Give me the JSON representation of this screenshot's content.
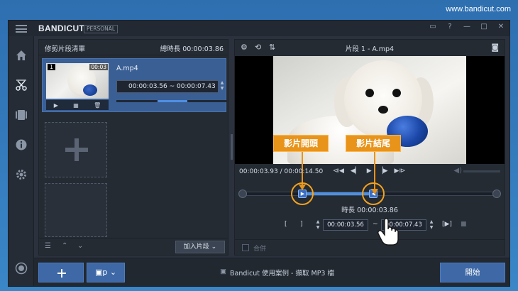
{
  "site_url": "www.bandicut.com",
  "app": {
    "logo": "BANDICUT",
    "edition": "PERSONAL"
  },
  "left_panel": {
    "title": "修剪片段清單",
    "total_duration": "總時長 00:00:03.86",
    "clip": {
      "index": "1",
      "thumb_time": "00:03",
      "name": "A.mp4",
      "range": "00:00:03.56 ~ 00:00:07.43",
      "progress_start": 0.37,
      "progress_length": 0.27
    },
    "add_segment_label": "加入片段"
  },
  "right_panel": {
    "title": "片段 1 - A.mp4",
    "time_readout": "00:00:03.93 / 00:00:14.50",
    "callout_start": "影片開頭",
    "callout_end": "影片結尾",
    "duration_label": "時長 00:00:03.86",
    "start_time": "00:00:03.56",
    "end_time": "00:00:07.43",
    "range_sep": "~",
    "merge_label": "合併",
    "selection": {
      "start": 0.236,
      "end": 0.515,
      "total_seconds": 14.5
    }
  },
  "bottom": {
    "mode_label": "▣p",
    "tip": "Bandicut 使用案例 - 擷取 MP3 檔",
    "start_label": "開始"
  },
  "colors": {
    "accent": "#4e8fe3",
    "callout": "#e8931a",
    "button": "#3e68a6"
  }
}
